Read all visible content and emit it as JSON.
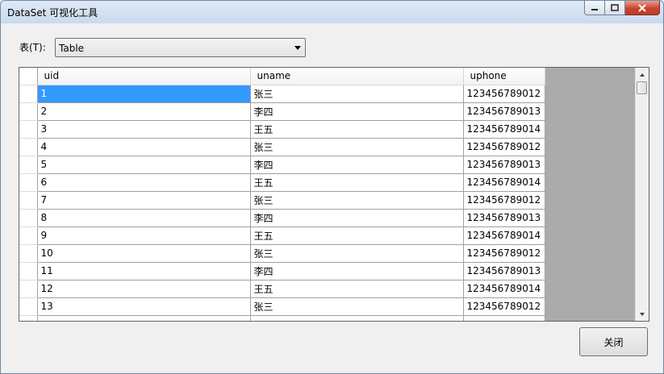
{
  "window": {
    "title": "DataSet 可视化工具",
    "controls": {
      "minimize_icon": "minimize-icon",
      "maximize_icon": "maximize-icon",
      "close_icon": "close-x-icon"
    }
  },
  "table_selector": {
    "label": "表(T):",
    "selected": "Table"
  },
  "grid": {
    "columns": [
      "uid",
      "uname",
      "uphone"
    ],
    "rows": [
      [
        "1",
        "张三",
        "123456789012"
      ],
      [
        "2",
        "李四",
        "123456789013"
      ],
      [
        "3",
        "王五",
        "123456789014"
      ],
      [
        "4",
        "张三",
        "123456789012"
      ],
      [
        "5",
        "李四",
        "123456789013"
      ],
      [
        "6",
        "王五",
        "123456789014"
      ],
      [
        "7",
        "张三",
        "123456789012"
      ],
      [
        "8",
        "李四",
        "123456789013"
      ],
      [
        "9",
        "王五",
        "123456789014"
      ],
      [
        "10",
        "张三",
        "123456789012"
      ],
      [
        "11",
        "李四",
        "123456789013"
      ],
      [
        "12",
        "王五",
        "123456789014"
      ],
      [
        "13",
        "张三",
        "123456789012"
      ],
      [
        "",
        "",
        ""
      ]
    ],
    "selected_row": 0,
    "selected_column": 0
  },
  "buttons": {
    "close_label": "关闭"
  },
  "colors": {
    "selection": "#3399ff",
    "grid_background": "#ababab"
  }
}
